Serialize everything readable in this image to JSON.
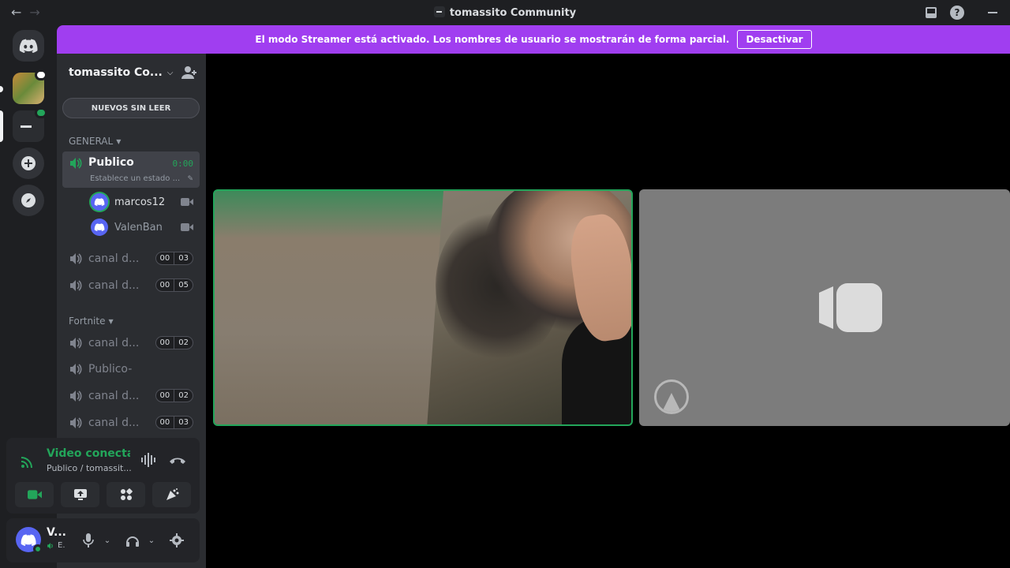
{
  "window": {
    "title": "tomassito Community"
  },
  "banner": {
    "message": "El modo Streamer está activado. Los nombres de usuario se mostrarán de forma parcial.",
    "button": "Desactivar"
  },
  "server": {
    "name": "tomassito Co...",
    "unread_button": "NUEVOS SIN LEER"
  },
  "categories": [
    {
      "name": "GENERAL",
      "channels": [
        {
          "name": "Publico",
          "active": true,
          "timer": "0:00",
          "status": "Establece un estado ...",
          "users": [
            {
              "name": "marcos12",
              "speaking": true
            },
            {
              "name": "ValenBan",
              "speaking": false
            }
          ]
        },
        {
          "name": "canal d...",
          "count_left": "00",
          "count_right": "03"
        },
        {
          "name": "canal d...",
          "count_left": "00",
          "count_right": "05"
        }
      ]
    },
    {
      "name": "Fortnite",
      "channels": [
        {
          "name": "canal d...",
          "count_left": "00",
          "count_right": "02"
        },
        {
          "name": "Publico-"
        },
        {
          "name": "canal d...",
          "count_left": "00",
          "count_right": "02"
        },
        {
          "name": "canal d...",
          "count_left": "00",
          "count_right": "03"
        }
      ]
    }
  ],
  "voice_panel": {
    "title": "Video conectado",
    "subtitle": "Publico / tomassit..."
  },
  "user_panel": {
    "name": "V...",
    "status": "E."
  },
  "icons": {
    "back": "arrow-left-icon",
    "forward": "arrow-right-icon",
    "inbox": "inbox-icon",
    "help": "help-icon",
    "minimize": "minimize-icon"
  },
  "colors": {
    "banner": "#a03ef0",
    "accent_green": "#23a55a",
    "blurple": "#5865f2"
  }
}
